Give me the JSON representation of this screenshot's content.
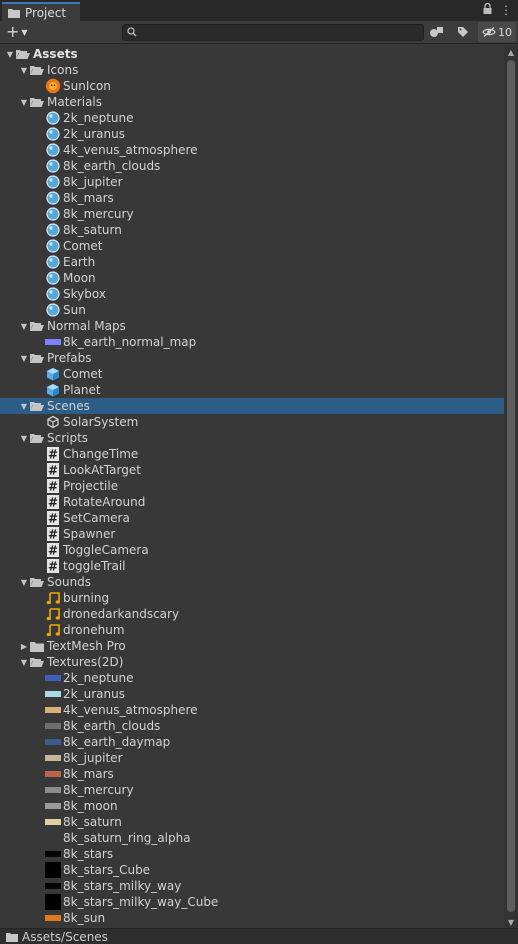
{
  "window": {
    "tab_title": "Project",
    "hidden_count": "10"
  },
  "status": {
    "path": "Assets/Scenes"
  },
  "tree": [
    {
      "label": "Assets",
      "depth": 0,
      "arrow": "open",
      "icon": "folder-open-icon",
      "bold": true
    },
    {
      "label": "Icons",
      "depth": 1,
      "arrow": "open",
      "icon": "folder-open-icon"
    },
    {
      "label": "SunIcon",
      "depth": 2,
      "icon": "sun-image-icon"
    },
    {
      "label": "Materials",
      "depth": 1,
      "arrow": "open",
      "icon": "folder-open-icon"
    },
    {
      "label": "2k_neptune",
      "depth": 2,
      "icon": "material-icon"
    },
    {
      "label": "2k_uranus",
      "depth": 2,
      "icon": "material-icon"
    },
    {
      "label": "4k_venus_atmosphere",
      "depth": 2,
      "icon": "material-icon"
    },
    {
      "label": "8k_earth_clouds",
      "depth": 2,
      "icon": "material-icon"
    },
    {
      "label": "8k_jupiter",
      "depth": 2,
      "icon": "material-icon"
    },
    {
      "label": "8k_mars",
      "depth": 2,
      "icon": "material-icon"
    },
    {
      "label": "8k_mercury",
      "depth": 2,
      "icon": "material-icon"
    },
    {
      "label": "8k_saturn",
      "depth": 2,
      "icon": "material-icon"
    },
    {
      "label": "Comet",
      "depth": 2,
      "icon": "material-icon"
    },
    {
      "label": "Earth",
      "depth": 2,
      "icon": "material-icon"
    },
    {
      "label": "Moon",
      "depth": 2,
      "icon": "material-icon"
    },
    {
      "label": "Skybox",
      "depth": 2,
      "icon": "material-icon"
    },
    {
      "label": "Sun",
      "depth": 2,
      "icon": "material-icon"
    },
    {
      "label": "Normal Maps",
      "depth": 1,
      "arrow": "open",
      "icon": "folder-open-icon"
    },
    {
      "label": "8k_earth_normal_map",
      "depth": 2,
      "icon": "texture-icon",
      "color": "#8080ff"
    },
    {
      "label": "Prefabs",
      "depth": 1,
      "arrow": "open",
      "icon": "folder-open-icon"
    },
    {
      "label": "Comet",
      "depth": 2,
      "icon": "prefab-icon"
    },
    {
      "label": "Planet",
      "depth": 2,
      "icon": "prefab-icon"
    },
    {
      "label": "Scenes",
      "depth": 1,
      "arrow": "open",
      "icon": "folder-open-icon",
      "selected": true
    },
    {
      "label": "SolarSystem",
      "depth": 2,
      "icon": "unity-scene-icon"
    },
    {
      "label": "Scripts",
      "depth": 1,
      "arrow": "open",
      "icon": "folder-open-icon"
    },
    {
      "label": "ChangeTime",
      "depth": 2,
      "icon": "script-icon"
    },
    {
      "label": "LookAtTarget",
      "depth": 2,
      "icon": "script-icon"
    },
    {
      "label": "Projectile",
      "depth": 2,
      "icon": "script-icon"
    },
    {
      "label": "RotateAround",
      "depth": 2,
      "icon": "script-icon"
    },
    {
      "label": "SetCamera",
      "depth": 2,
      "icon": "script-icon"
    },
    {
      "label": "Spawner",
      "depth": 2,
      "icon": "script-icon"
    },
    {
      "label": "ToggleCamera",
      "depth": 2,
      "icon": "script-icon"
    },
    {
      "label": "toggleTrail",
      "depth": 2,
      "icon": "script-icon"
    },
    {
      "label": "Sounds",
      "depth": 1,
      "arrow": "open",
      "icon": "folder-open-icon"
    },
    {
      "label": "burning",
      "depth": 2,
      "icon": "audio-icon"
    },
    {
      "label": "dronedarkandscary",
      "depth": 2,
      "icon": "audio-icon"
    },
    {
      "label": "dronehum",
      "depth": 2,
      "icon": "audio-icon"
    },
    {
      "label": "TextMesh Pro",
      "depth": 1,
      "arrow": "closed",
      "icon": "folder-icon"
    },
    {
      "label": "Textures(2D)",
      "depth": 1,
      "arrow": "open",
      "icon": "folder-open-icon"
    },
    {
      "label": "2k_neptune",
      "depth": 2,
      "icon": "texture-icon",
      "color": "#3f5fbf"
    },
    {
      "label": "2k_uranus",
      "depth": 2,
      "icon": "texture-icon",
      "color": "#a9dde6"
    },
    {
      "label": "4k_venus_atmosphere",
      "depth": 2,
      "icon": "texture-icon",
      "color": "#d9b07a"
    },
    {
      "label": "8k_earth_clouds",
      "depth": 2,
      "icon": "texture-icon",
      "color": "#6e6e6e"
    },
    {
      "label": "8k_earth_daymap",
      "depth": 2,
      "icon": "texture-icon",
      "color": "#3a5c8c"
    },
    {
      "label": "8k_jupiter",
      "depth": 2,
      "icon": "texture-icon",
      "color": "#c8b49a"
    },
    {
      "label": "8k_mars",
      "depth": 2,
      "icon": "texture-icon",
      "color": "#b8664a"
    },
    {
      "label": "8k_mercury",
      "depth": 2,
      "icon": "texture-icon",
      "color": "#8c8c8c"
    },
    {
      "label": "8k_moon",
      "depth": 2,
      "icon": "texture-icon",
      "color": "#9a9a9a"
    },
    {
      "label": "8k_saturn",
      "depth": 2,
      "icon": "texture-icon",
      "color": "#e0cfa0"
    },
    {
      "label": "8k_saturn_ring_alpha",
      "depth": 2,
      "icon": "texture-icon",
      "color": "#383838"
    },
    {
      "label": "8k_stars",
      "depth": 2,
      "icon": "texture-icon",
      "color": "#050505"
    },
    {
      "label": "8k_stars_Cube",
      "depth": 2,
      "icon": "cubemap-icon",
      "color": "#000000"
    },
    {
      "label": "8k_stars_milky_way",
      "depth": 2,
      "icon": "texture-icon",
      "color": "#050505"
    },
    {
      "label": "8k_stars_milky_way_Cube",
      "depth": 2,
      "icon": "cubemap-icon",
      "color": "#000000"
    },
    {
      "label": "8k_sun",
      "depth": 2,
      "icon": "texture-icon",
      "color": "#e07a20"
    }
  ]
}
